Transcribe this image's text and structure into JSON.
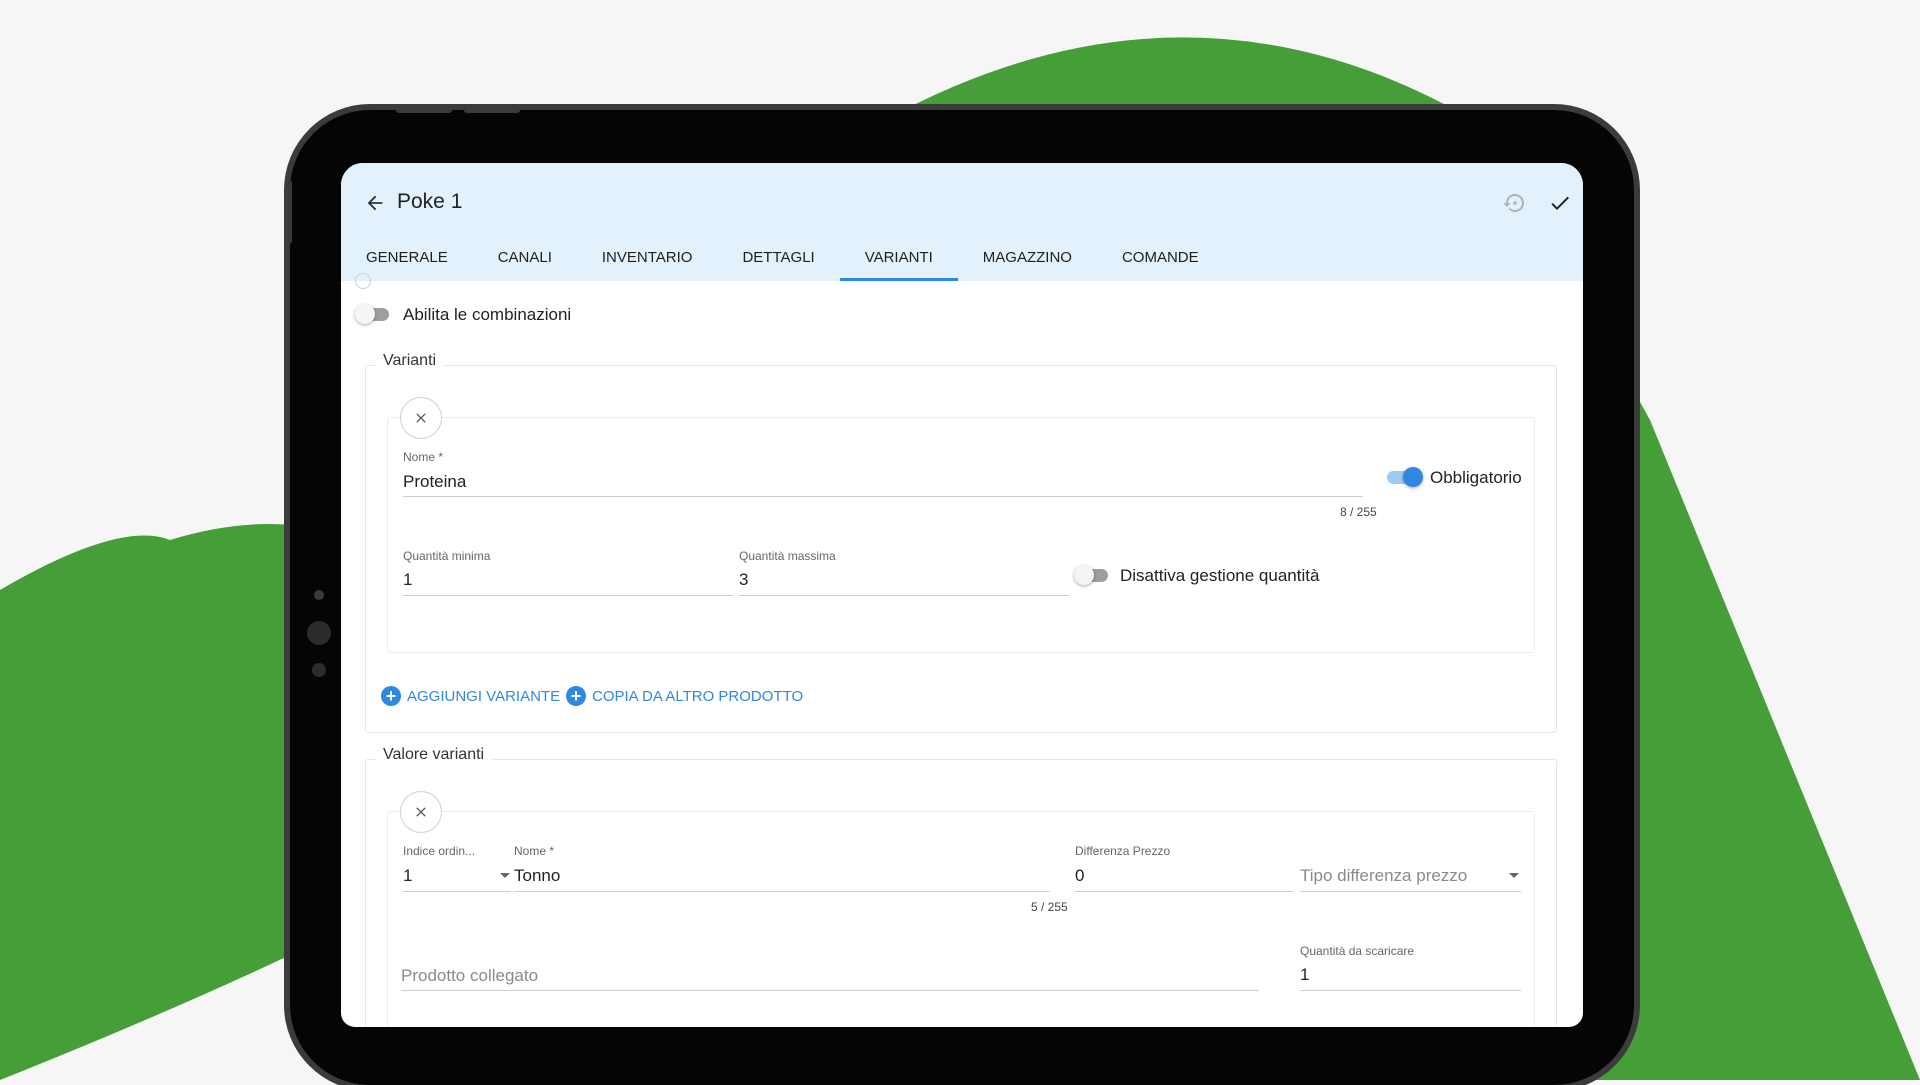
{
  "app": {
    "title": "Poke 1"
  },
  "tabs": [
    {
      "label": "GENERALE"
    },
    {
      "label": "CANALI"
    },
    {
      "label": "INVENTARIO"
    },
    {
      "label": "DETTAGLI"
    },
    {
      "label": "VARIANTI",
      "active": true
    },
    {
      "label": "MAGAZZINO"
    },
    {
      "label": "COMANDE"
    }
  ],
  "combinations": {
    "label": "Abilita le combinazioni",
    "enabled": false
  },
  "variants": {
    "legend": "Varianti",
    "item": {
      "name_label": "Nome *",
      "name_value": "Proteina",
      "name_counter": "8 / 255",
      "required_label": "Obbligatorio",
      "required": true,
      "min_label": "Quantità minima",
      "min_value": "1",
      "max_label": "Quantità massima",
      "max_value": "3",
      "disable_qty_label": "Disattiva gestione quantità",
      "disable_qty": false
    },
    "add_variant_label": "AGGIUNGI VARIANTE",
    "copy_label": "COPIA DA ALTRO PRODOTTO"
  },
  "variant_values": {
    "legend": "Valore varianti",
    "item": {
      "index_label": "Indice ordin...",
      "index_value": "1",
      "name_label": "Nome *",
      "name_value": "Tonno",
      "name_counter": "5 / 255",
      "price_diff_label": "Differenza Prezzo",
      "price_diff_value": "0",
      "price_type_placeholder": "Tipo differenza prezzo",
      "linked_product_placeholder": "Prodotto collegato",
      "qty_unload_label": "Quantità da scaricare",
      "qty_unload_value": "1"
    }
  },
  "icons": {
    "back": "arrow-left-icon",
    "restore": "history-icon",
    "confirm": "check-icon",
    "close": "close-icon",
    "add": "plus-circle-icon"
  },
  "colors": {
    "accent": "#2f88e0",
    "appbar_bg": "#e3f1fc",
    "background_green": "#459e37"
  }
}
